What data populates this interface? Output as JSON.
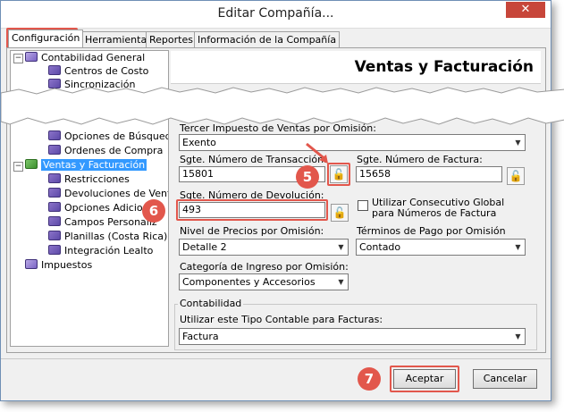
{
  "window": {
    "title": "Editar Compañía...",
    "close_label": "✕"
  },
  "tabs": [
    {
      "label": "Configuración"
    },
    {
      "label": "Herramientas"
    },
    {
      "label": "Reportes"
    },
    {
      "label": "Información de la Compañía"
    }
  ],
  "tree": {
    "items": [
      {
        "label": "Contabilidad General"
      },
      {
        "label": "Centros de Costo"
      },
      {
        "label": "Sincronización"
      },
      {
        "label": "Opciones de Búsqueda"
      },
      {
        "label": "Ordenes de Compra"
      },
      {
        "label": "Ventas y Facturación"
      },
      {
        "label": "Restricciones"
      },
      {
        "label": "Devoluciones de Venta"
      },
      {
        "label": "Opciones Adicion"
      },
      {
        "label": "Campos Personaliz"
      },
      {
        "label": "Planillas (Costa Rica)"
      },
      {
        "label": "Integración Lealto"
      },
      {
        "label": "Impuestos"
      }
    ]
  },
  "section": {
    "title": "Ventas y Facturación"
  },
  "form": {
    "tax_label": "Tercer Impuesto de Ventas por Omisión:",
    "tax_value": "Exento",
    "next_transaction_label": "Sgte. Número de Transacción:",
    "next_transaction_value": "15801",
    "next_invoice_label": "Sgte. Número de Factura:",
    "next_invoice_value": "15658",
    "next_return_label": "Sgte. Número de Devolución:",
    "next_return_value": "493",
    "global_consecutive_label": "Utilizar Consecutivo Global para Números de Factura",
    "price_level_label": "Nivel de Precios por Omisión:",
    "price_level_value": "Detalle 2",
    "payment_terms_label": "Términos de Pago por Omisión",
    "payment_terms_value": "Contado",
    "income_category_label": "Categoría de Ingreso por Omisión:",
    "income_category_value": "Componentes y Accesorios"
  },
  "accounting": {
    "group_label": "Contabilidad",
    "type_label": "Utilizar este Tipo Contable para Facturas:",
    "type_value": "Factura"
  },
  "buttons": {
    "accept": "Aceptar",
    "cancel": "Cancelar"
  },
  "badges": {
    "five": "5",
    "six": "6",
    "seven": "7"
  },
  "colors": {
    "accent_highlight": "#e2574c",
    "selection": "#3399ff"
  }
}
